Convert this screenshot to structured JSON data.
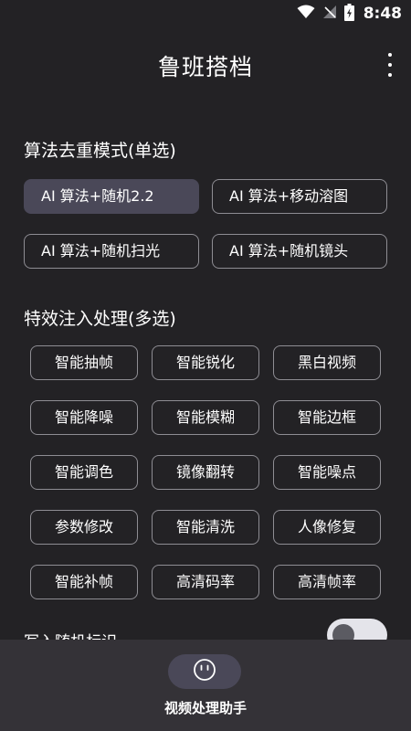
{
  "status_bar": {
    "time": "8:48",
    "icons": [
      "wifi-icon",
      "no-signal-icon",
      "battery-charging-icon"
    ]
  },
  "header": {
    "title": "鲁班搭档",
    "menu_icon": "more-vert-icon"
  },
  "dedup_section": {
    "title": "算法去重模式(单选)",
    "options": [
      {
        "label": "AI 算法+随机2.2",
        "selected": true
      },
      {
        "label": "AI 算法+移动溶图",
        "selected": false
      },
      {
        "label": "AI 算法+随机扫光",
        "selected": false
      },
      {
        "label": "AI 算法+随机镜头",
        "selected": false
      }
    ]
  },
  "effects_section": {
    "title": "特效注入处理(多选)",
    "chips": [
      "智能抽帧",
      "智能锐化",
      "黑白视频",
      "智能降噪",
      "智能模糊",
      "智能边框",
      "智能调色",
      "镜像翻转",
      "智能噪点",
      "参数修改",
      "智能清洗",
      "人像修复",
      "智能补帧",
      "高清码率",
      "高清帧率"
    ]
  },
  "random_mark": {
    "label": "写入随机标识",
    "enabled": false
  },
  "bottom_nav": {
    "label": "视频处理助手",
    "icon": "smiley-face-icon"
  },
  "colors": {
    "background": "#232225",
    "selected_fill": "#4a4858",
    "chip_border": "#8e8d93",
    "nav_background": "#343237"
  }
}
